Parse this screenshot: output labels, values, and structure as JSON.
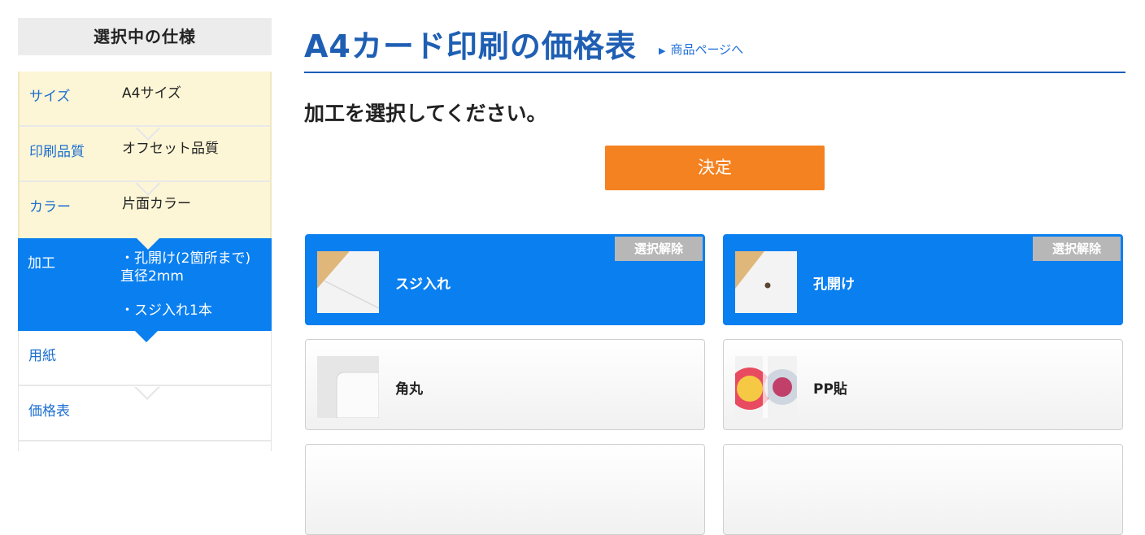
{
  "sidebar": {
    "heading": "選択中の仕様",
    "steps": [
      {
        "label": "サイズ",
        "value": "A4サイズ"
      },
      {
        "label": "印刷品質",
        "value": "オフセット品質"
      },
      {
        "label": "カラー",
        "value": "片面カラー"
      },
      {
        "label": "加工",
        "value1": "・孔開け(2箇所まで)直径2mm",
        "value2": "・スジ入れ1本"
      },
      {
        "label": "用紙",
        "value": ""
      },
      {
        "label": "価格表",
        "value": ""
      }
    ]
  },
  "main": {
    "title": "A4カード印刷の価格表",
    "product_link": "商品ページへ",
    "prompt": "加工を選択してください。",
    "decide_label": "決定",
    "options": [
      {
        "name": "スジ入れ",
        "selected": true,
        "deselect_label": "選択解除"
      },
      {
        "name": "孔開け",
        "selected": true,
        "deselect_label": "選択解除"
      },
      {
        "name": "角丸",
        "selected": false
      },
      {
        "name": "PP貼",
        "selected": false
      }
    ]
  },
  "colors": {
    "accent_blue": "#0a7ff0",
    "title_blue": "#1f5fb3",
    "button_orange": "#f58220",
    "done_step_bg": "#fdf6d6"
  }
}
